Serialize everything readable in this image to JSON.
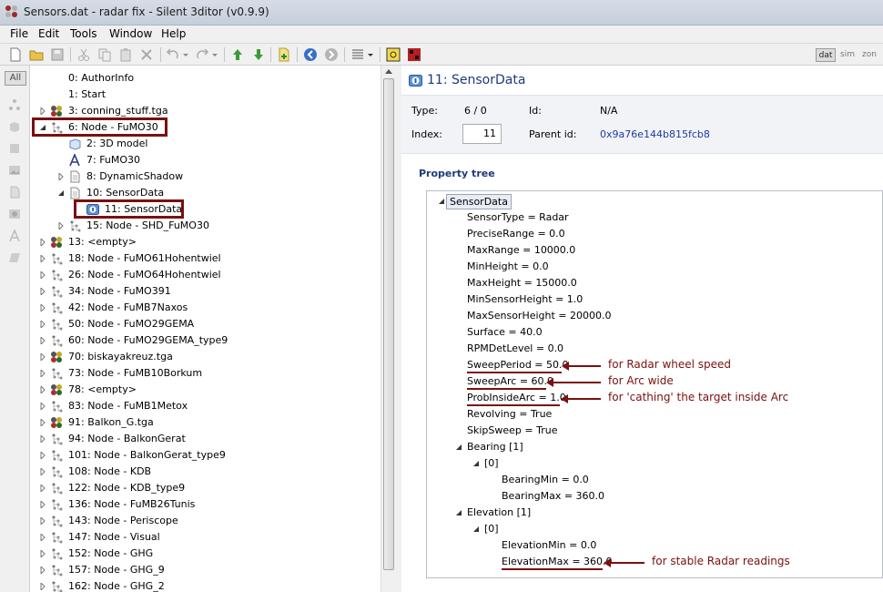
{
  "window": {
    "title": "Sensors.dat - radar fix - Silent 3ditor (v0.9.9)"
  },
  "menu": [
    "File",
    "Edit",
    "Tools",
    "Window",
    "Help"
  ],
  "view_modes": [
    "dat",
    "sim",
    "zon"
  ],
  "left_filter": "All",
  "tree": [
    {
      "label": "0: AuthorInfo",
      "icon": "none-icon",
      "level": 1,
      "exp": "none"
    },
    {
      "label": "1: Start",
      "icon": "none-icon",
      "level": 1,
      "exp": "none"
    },
    {
      "label": "3: conning_stuff.tga",
      "icon": "texture-icon",
      "level": 1,
      "exp": "collapsed"
    },
    {
      "label": "6: Node - FuMO30",
      "icon": "node-icon",
      "level": 1,
      "exp": "expanded"
    },
    {
      "label": "2: 3D model",
      "icon": "model-icon",
      "level": 2,
      "exp": "none"
    },
    {
      "label": "7: FuMO30",
      "icon": "label-icon",
      "level": 2,
      "exp": "none"
    },
    {
      "label": "8: DynamicShadow",
      "icon": "document-icon",
      "level": 2,
      "exp": "collapsed"
    },
    {
      "label": "10: SensorData",
      "icon": "document-icon",
      "level": 2,
      "exp": "expanded"
    },
    {
      "label": "11: SensorData",
      "icon": "sensor-icon",
      "level": 3,
      "exp": "none"
    },
    {
      "label": "15: Node - SHD_FuMO30",
      "icon": "node-icon",
      "level": 2,
      "exp": "collapsed"
    },
    {
      "label": "13: <empty>",
      "icon": "texture-icon",
      "level": 1,
      "exp": "collapsed"
    },
    {
      "label": "18: Node - FuMO61Hohentwiel",
      "icon": "node-icon",
      "level": 1,
      "exp": "collapsed"
    },
    {
      "label": "26: Node - FuMO64Hohentwiel",
      "icon": "node-icon",
      "level": 1,
      "exp": "collapsed"
    },
    {
      "label": "34: Node - FuMO391",
      "icon": "node-icon",
      "level": 1,
      "exp": "collapsed"
    },
    {
      "label": "42: Node - FuMB7Naxos",
      "icon": "node-icon",
      "level": 1,
      "exp": "collapsed"
    },
    {
      "label": "50: Node - FuMO29GEMA",
      "icon": "node-icon",
      "level": 1,
      "exp": "collapsed"
    },
    {
      "label": "60: Node - FuMO29GEMA_type9",
      "icon": "node-icon",
      "level": 1,
      "exp": "collapsed"
    },
    {
      "label": "70: biskayakreuz.tga",
      "icon": "texture-icon",
      "level": 1,
      "exp": "collapsed"
    },
    {
      "label": "73: Node - FuMB10Borkum",
      "icon": "node-icon",
      "level": 1,
      "exp": "collapsed"
    },
    {
      "label": "78: <empty>",
      "icon": "texture-icon",
      "level": 1,
      "exp": "collapsed"
    },
    {
      "label": "83: Node - FuMB1Metox",
      "icon": "node-icon",
      "level": 1,
      "exp": "collapsed"
    },
    {
      "label": "91: Balkon_G.tga",
      "icon": "texture-icon",
      "level": 1,
      "exp": "collapsed"
    },
    {
      "label": "94: Node - BalkonGerat",
      "icon": "node-icon",
      "level": 1,
      "exp": "collapsed"
    },
    {
      "label": "101: Node - BalkonGerat_type9",
      "icon": "node-icon",
      "level": 1,
      "exp": "collapsed"
    },
    {
      "label": "108: Node - KDB",
      "icon": "node-icon",
      "level": 1,
      "exp": "collapsed"
    },
    {
      "label": "122: Node - KDB_type9",
      "icon": "node-icon",
      "level": 1,
      "exp": "collapsed"
    },
    {
      "label": "136: Node - FuMB26Tunis",
      "icon": "node-icon",
      "level": 1,
      "exp": "collapsed"
    },
    {
      "label": "143: Node - Periscope",
      "icon": "node-icon",
      "level": 1,
      "exp": "collapsed"
    },
    {
      "label": "147: Node - Visual",
      "icon": "node-icon",
      "level": 1,
      "exp": "collapsed"
    },
    {
      "label": "152: Node - GHG",
      "icon": "node-icon",
      "level": 1,
      "exp": "collapsed"
    },
    {
      "label": "157: Node - GHG_9",
      "icon": "node-icon",
      "level": 1,
      "exp": "collapsed"
    },
    {
      "label": "162: Node - GHG_2",
      "icon": "node-icon",
      "level": 1,
      "exp": "collapsed"
    }
  ],
  "detail": {
    "title": "11: SensorData",
    "type_label": "Type:",
    "type_value": "6 / 0",
    "id_label": "Id:",
    "id_value": "N/A",
    "index_label": "Index:",
    "index_value": "11",
    "parent_label": "Parent id:",
    "parent_value": "0x9a76e144b815fcb8",
    "property_tree_label": "Property tree"
  },
  "props": [
    {
      "label": "SensorData",
      "level": 0,
      "exp": "expanded"
    },
    {
      "label": "SensorType = Radar",
      "level": 1,
      "exp": "none"
    },
    {
      "label": "PreciseRange = 0.0",
      "level": 1,
      "exp": "none"
    },
    {
      "label": "MaxRange = 10000.0",
      "level": 1,
      "exp": "none"
    },
    {
      "label": "MinHeight = 0.0",
      "level": 1,
      "exp": "none"
    },
    {
      "label": "MaxHeight = 15000.0",
      "level": 1,
      "exp": "none"
    },
    {
      "label": "MinSensorHeight = 1.0",
      "level": 1,
      "exp": "none"
    },
    {
      "label": "MaxSensorHeight = 20000.0",
      "level": 1,
      "exp": "none"
    },
    {
      "label": "Surface = 40.0",
      "level": 1,
      "exp": "none"
    },
    {
      "label": "RPMDetLevel = 0.0",
      "level": 1,
      "exp": "none"
    },
    {
      "label": "SweepPeriod = 50.0",
      "level": 1,
      "exp": "none"
    },
    {
      "label": "SweepArc = 60.0",
      "level": 1,
      "exp": "none"
    },
    {
      "label": "ProbInsideArc = 1.0",
      "level": 1,
      "exp": "none"
    },
    {
      "label": "Revolving = True",
      "level": 1,
      "exp": "none"
    },
    {
      "label": "SkipSweep = True",
      "level": 1,
      "exp": "none"
    },
    {
      "label": "Bearing [1]",
      "level": 1,
      "exp": "expanded"
    },
    {
      "label": "[0]",
      "level": 2,
      "exp": "expanded"
    },
    {
      "label": "BearingMin = 0.0",
      "level": 3,
      "exp": "none"
    },
    {
      "label": "BearingMax = 360.0",
      "level": 3,
      "exp": "none"
    },
    {
      "label": "Elevation [1]",
      "level": 1,
      "exp": "expanded"
    },
    {
      "label": "[0]",
      "level": 2,
      "exp": "expanded"
    },
    {
      "label": "ElevationMin = 0.0",
      "level": 3,
      "exp": "none"
    },
    {
      "label": "ElevationMax = 360.0",
      "level": 3,
      "exp": "none"
    }
  ],
  "annotations": [
    {
      "prop": 10,
      "text": "for Radar wheel speed"
    },
    {
      "prop": 11,
      "text": "for Arc wide"
    },
    {
      "prop": 12,
      "text": "for 'cathing' the target inside Arc"
    },
    {
      "prop": 22,
      "text": "for stable Radar readings"
    }
  ],
  "colors": {
    "highlight": "#7a1010",
    "accent": "#1d3b7a"
  }
}
